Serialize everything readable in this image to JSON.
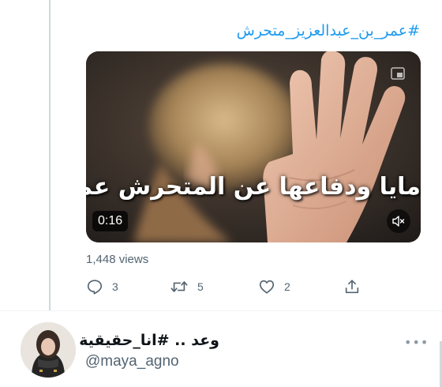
{
  "tweet": {
    "hashtag": "#عمر_بن_عبدالعزيز_متحرش",
    "video": {
      "overlay_title": "مايا ودفاعها عن المتحرش عمر",
      "duration": "0:16",
      "icons": {
        "pip": "picture-in-picture-icon",
        "mute": "muted-speaker-icon"
      }
    },
    "views": "1,448 views",
    "actions": {
      "reply_count": "3",
      "retweet_count": "5",
      "like_count": "2"
    }
  },
  "next_tweet": {
    "display_name": "وعد .. #انا_حقيقية",
    "handle": "@maya_agno",
    "more_label": "•••"
  },
  "colors": {
    "link": "#1d9bf0",
    "muted": "#536471",
    "text": "#0f1419"
  }
}
